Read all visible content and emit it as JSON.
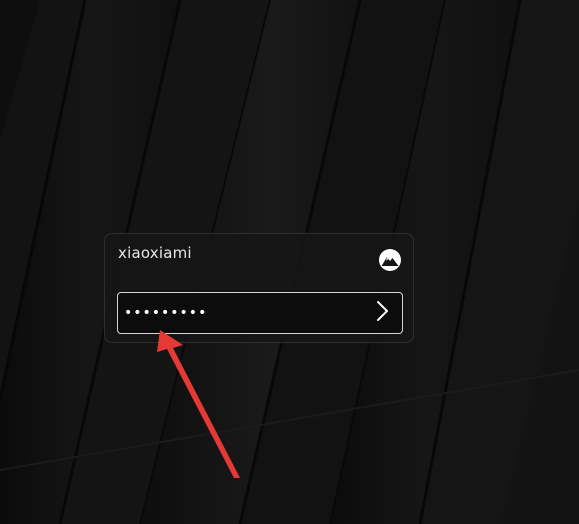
{
  "login": {
    "username": "xiaoxiami",
    "password_masked": "•••••••••",
    "password_value": "•••••••••"
  },
  "icons": {
    "distro_icon": "mountain-logo-icon",
    "submit_icon": "chevron-right-icon"
  },
  "colors": {
    "background": "#121212",
    "card_border": "#2e2e2e",
    "field_border": "#d6d6d6",
    "text": "#e8e8e8",
    "annotation_arrow": "#e53935"
  }
}
